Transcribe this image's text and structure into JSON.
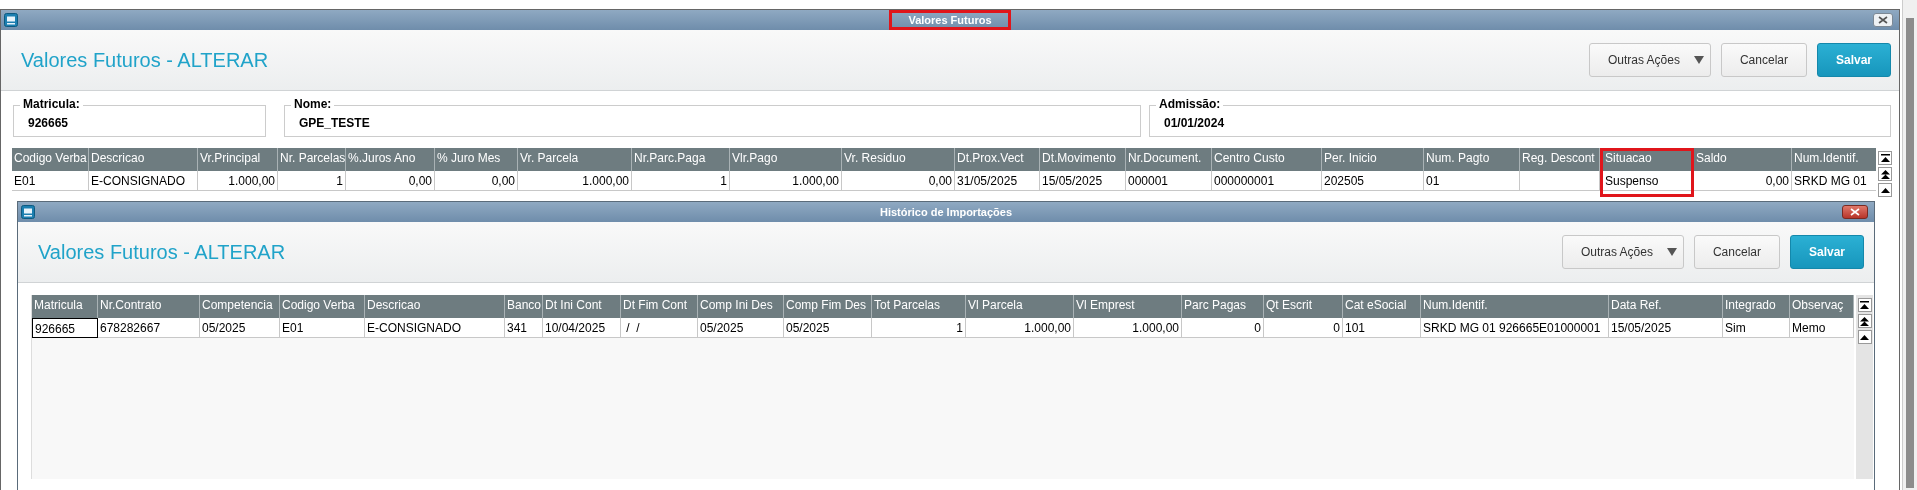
{
  "window": {
    "title": "Valores Futuros",
    "title_highlighted": true
  },
  "header": {
    "title": "Valores Futuros - ALTERAR",
    "buttons": [
      {
        "label": "Outras Ações",
        "kind": "menu"
      },
      {
        "label": "Cancelar",
        "kind": "plain"
      },
      {
        "label": "Salvar",
        "kind": "primary"
      }
    ]
  },
  "fields": [
    {
      "label": "Matricula:",
      "value": "926665"
    },
    {
      "label": "Nome:",
      "value": "GPE_TESTE"
    },
    {
      "label": "Admissão:",
      "value": "01/01/2024"
    }
  ],
  "table": {
    "columns": [
      {
        "name": "Codigo Verba",
        "kind": "text",
        "highlighted": false
      },
      {
        "name": "Descricao",
        "kind": "text",
        "highlighted": false
      },
      {
        "name": "Vr.Principal",
        "kind": "number",
        "highlighted": false
      },
      {
        "name": "Nr. Parcelas",
        "kind": "number",
        "highlighted": false
      },
      {
        "name": "%.Juros Ano",
        "kind": "number",
        "highlighted": false
      },
      {
        "name": "% Juro Mes",
        "kind": "number",
        "highlighted": false
      },
      {
        "name": "Vr. Parcela",
        "kind": "number",
        "highlighted": false
      },
      {
        "name": "Nr.Parc.Paga",
        "kind": "number",
        "highlighted": false
      },
      {
        "name": "Vlr.Pago",
        "kind": "number",
        "highlighted": false
      },
      {
        "name": "Vr. Residuo",
        "kind": "number",
        "highlighted": false
      },
      {
        "name": "Dt.Prox.Vect",
        "kind": "text",
        "highlighted": false
      },
      {
        "name": "Dt.Movimento",
        "kind": "text",
        "highlighted": false
      },
      {
        "name": "Nr.Document.",
        "kind": "text",
        "highlighted": false
      },
      {
        "name": "Centro Custo",
        "kind": "text",
        "highlighted": false
      },
      {
        "name": "Per. Inicio",
        "kind": "text",
        "highlighted": false
      },
      {
        "name": "Num. Pagto",
        "kind": "text",
        "highlighted": false
      },
      {
        "name": "Reg. Descont",
        "kind": "text",
        "highlighted": false
      },
      {
        "name": "Situacao",
        "kind": "text",
        "highlighted": true
      },
      {
        "name": "Saldo",
        "kind": "number",
        "highlighted": false
      },
      {
        "name": "Num.Identif.",
        "kind": "text",
        "highlighted": false
      }
    ],
    "rows": [
      [
        "E01",
        "E-CONSIGNADO",
        "1.000,00",
        "1",
        "0,00",
        "0,00",
        "1.000,00",
        "1",
        "1.000,00",
        "0,00",
        "31/05/2025",
        "15/05/2025",
        "000001",
        "000000001",
        "202505",
        "01",
        null,
        "Suspenso",
        "0,00",
        "SRKD MG 01"
      ]
    ]
  },
  "dialog": {
    "title": "Histórico de Importações",
    "header": {
      "title": "Valores Futuros - ALTERAR",
      "buttons": [
        {
          "label": "Outras Ações",
          "kind": "menu"
        },
        {
          "label": "Cancelar",
          "kind": "plain"
        },
        {
          "label": "Salvar",
          "kind": "primary"
        }
      ]
    },
    "table": {
      "columns": [
        {
          "name": "Matricula",
          "kind": "text",
          "focused": true
        },
        {
          "name": "Nr.Contrato",
          "kind": "text",
          "focused": false
        },
        {
          "name": "Competencia",
          "kind": "text",
          "focused": false
        },
        {
          "name": "Codigo Verba",
          "kind": "text",
          "focused": false
        },
        {
          "name": "Descricao",
          "kind": "text",
          "focused": false
        },
        {
          "name": "Banco",
          "kind": "text",
          "focused": false
        },
        {
          "name": "Dt Ini Cont",
          "kind": "text",
          "focused": false
        },
        {
          "name": "Dt Fim Cont",
          "kind": "text",
          "focused": false
        },
        {
          "name": "Comp Ini Des",
          "kind": "text",
          "focused": false
        },
        {
          "name": "Comp Fim Des",
          "kind": "text",
          "focused": false
        },
        {
          "name": "Tot Parcelas",
          "kind": "number",
          "focused": false
        },
        {
          "name": "Vl Parcela",
          "kind": "number",
          "focused": false
        },
        {
          "name": "Vl Emprest",
          "kind": "number",
          "focused": false
        },
        {
          "name": "Parc Pagas",
          "kind": "number",
          "focused": false
        },
        {
          "name": "Qt Escrit",
          "kind": "number",
          "focused": false
        },
        {
          "name": "Cat eSocial",
          "kind": "text",
          "focused": false
        },
        {
          "name": "Num.Identif.",
          "kind": "text",
          "focused": false
        },
        {
          "name": "Data Ref.",
          "kind": "text",
          "focused": false
        },
        {
          "name": "Integrado",
          "kind": "text",
          "focused": false
        },
        {
          "name": "Observaç",
          "kind": "text",
          "focused": false
        }
      ],
      "rows": [
        [
          "926665",
          "678282667",
          "05/2025",
          "E01",
          "E-CONSIGNADO",
          "341",
          "10/04/2025",
          " /  /",
          "05/2025",
          "05/2025",
          "1",
          "1.000,00",
          "1.000,00",
          "0",
          "0",
          "101",
          "SRKD MG 01 926665E01000001",
          "15/05/2025",
          "Sim",
          "Memo"
        ]
      ]
    }
  }
}
